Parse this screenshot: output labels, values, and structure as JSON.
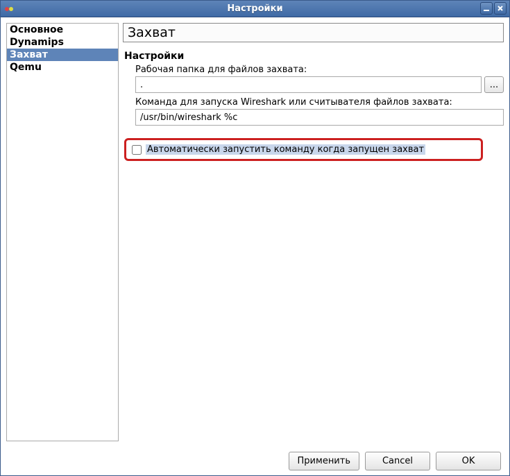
{
  "window": {
    "title": "Настройки"
  },
  "sidebar": {
    "items": [
      {
        "label": "Основное",
        "selected": false
      },
      {
        "label": "Dynamips",
        "selected": false
      },
      {
        "label": "Захват",
        "selected": true
      },
      {
        "label": "Qemu",
        "selected": false
      }
    ]
  },
  "main": {
    "page_title": "Захват",
    "section_title": "Настройки",
    "working_dir_label": "Рабочая папка для файлов захвата:",
    "working_dir_value": ".",
    "browse_label": "...",
    "command_label": "Команда для запуска Wireshark или считывателя файлов захвата:",
    "command_value": "/usr/bin/wireshark %c",
    "auto_start_label": "Автоматически запустить команду когда запущен захват",
    "auto_start_checked": false
  },
  "buttons": {
    "apply": "Применить",
    "cancel": "Cancel",
    "ok": "OK"
  }
}
